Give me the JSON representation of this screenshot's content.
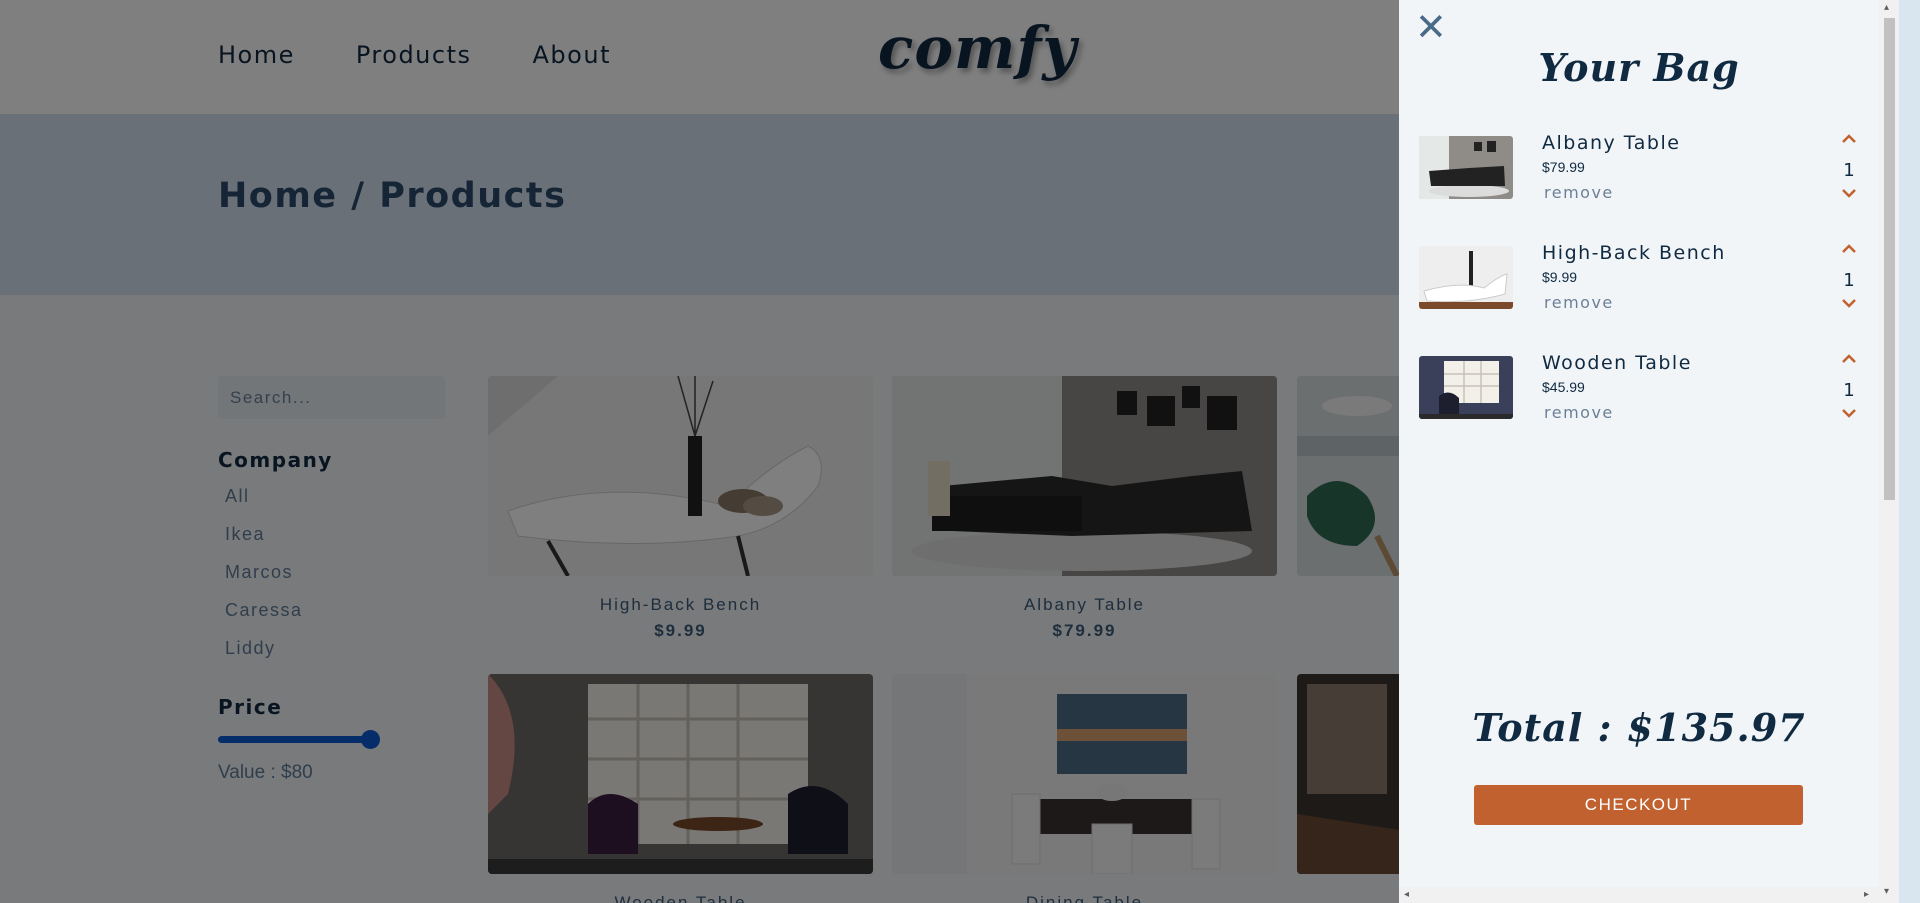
{
  "nav": {
    "links": [
      "Home",
      "Products",
      "About"
    ],
    "logo": "comfy"
  },
  "hero": {
    "title": "Home / Products"
  },
  "filters": {
    "search_placeholder": "Search...",
    "company_title": "Company",
    "companies": [
      "All",
      "Ikea",
      "Marcos",
      "Caressa",
      "Liddy"
    ],
    "price_title": "Price",
    "price_value": "Value : $80",
    "price_slider_fraction": 1.0
  },
  "products": [
    {
      "name": "High-Back Bench",
      "price": "$9.99"
    },
    {
      "name": "Albany Table",
      "price": "$79.99"
    },
    {
      "name": "",
      "price": ""
    },
    {
      "name": "Wooden Table",
      "price": ""
    },
    {
      "name": "Dining Table",
      "price": ""
    },
    {
      "name": "",
      "price": ""
    }
  ],
  "cart": {
    "title": "Your Bag",
    "items": [
      {
        "name": "Albany Table",
        "price": "$79.99",
        "remove": "remove",
        "qty": "1"
      },
      {
        "name": "High-Back Bench",
        "price": "$9.99",
        "remove": "remove",
        "qty": "1"
      },
      {
        "name": "Wooden Table",
        "price": "$45.99",
        "remove": "remove",
        "qty": "1"
      }
    ],
    "total": "Total : $135.97",
    "checkout": "CHECKOUT"
  },
  "icons": {
    "close": "close-icon",
    "increase": "chevron-up-icon",
    "decrease": "chevron-down-icon"
  },
  "colors": {
    "accent": "#c0612f",
    "primary_text": "#102a42",
    "slider": "#0a5bd3"
  }
}
